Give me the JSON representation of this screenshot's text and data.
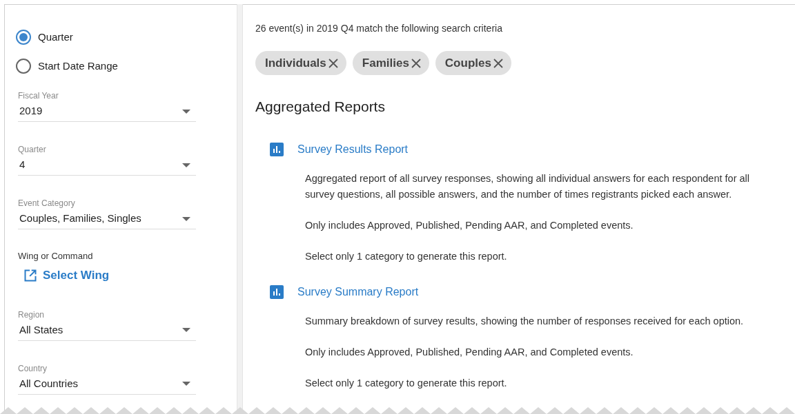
{
  "filters": {
    "date_mode": [
      {
        "label": "Quarter",
        "selected": true
      },
      {
        "label": "Start Date Range",
        "selected": false
      }
    ],
    "fields": [
      {
        "kind": "select",
        "label": "Fiscal Year",
        "value": "2019"
      },
      {
        "kind": "select",
        "label": "Quarter",
        "value": "4"
      },
      {
        "kind": "select",
        "label": "Event Category",
        "value": "Couples, Families, Singles"
      },
      {
        "kind": "link",
        "label": "Wing or Command",
        "value": "Select Wing"
      },
      {
        "kind": "select",
        "label": "Region",
        "value": "All States"
      },
      {
        "kind": "select",
        "label": "Country",
        "value": "All Countries"
      }
    ]
  },
  "results": {
    "summary": "26 event(s) in 2019 Q4 match the following search criteria",
    "chips": [
      "Individuals",
      "Families",
      "Couples"
    ],
    "heading": "Aggregated Reports",
    "reports": [
      {
        "title": "Survey Results Report",
        "paragraphs": [
          "Aggregated report of all survey responses, showing all individual answers for each respondent for all survey questions, all possible answers, and the number of times registrants picked each answer.",
          "Only includes Approved, Published, Pending AAR, and Completed events.",
          "Select only 1 category to generate this report."
        ]
      },
      {
        "title": "Survey Summary Report",
        "paragraphs": [
          "Summary breakdown of survey results, showing the number of responses received for each option.",
          "Only includes Approved, Published, Pending AAR, and Completed events.",
          "Select only 1 category to generate this report."
        ]
      }
    ]
  }
}
